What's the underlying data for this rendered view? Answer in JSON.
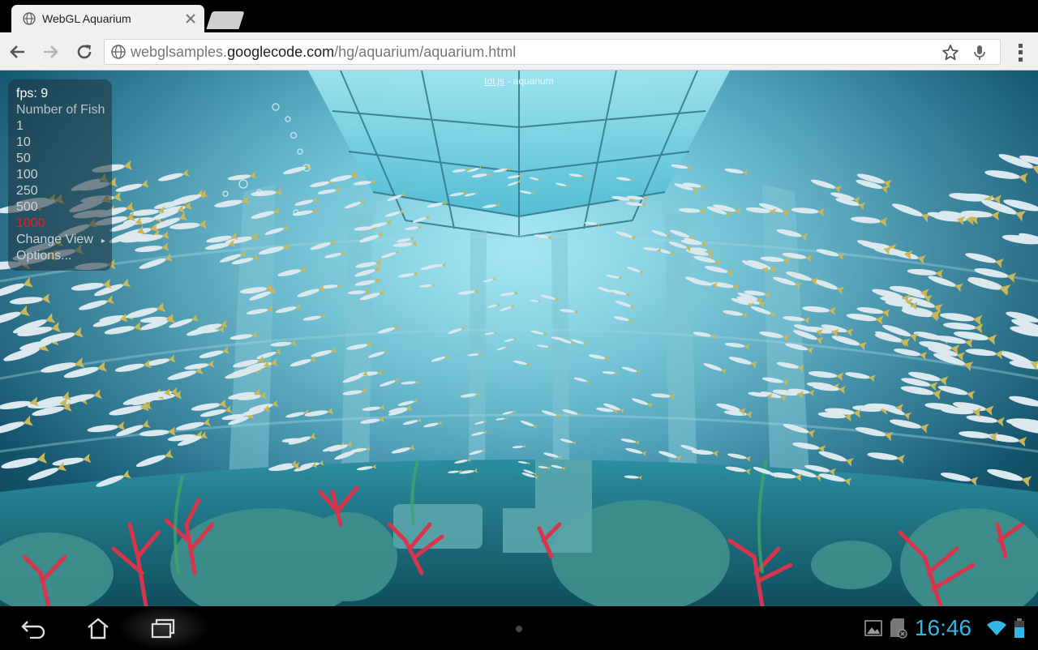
{
  "browser": {
    "tab": {
      "title": "WebGL Aquarium"
    },
    "url": {
      "prefix": "webglsamples.",
      "host": "googlecode.com",
      "path": "/hg/aquarium/aquarium.html"
    }
  },
  "page": {
    "caption_link": "tdl.js",
    "caption_rest": " - aquarium",
    "panel": {
      "fps": "fps: 9",
      "heading": "Number of Fish",
      "options": [
        "1",
        "10",
        "50",
        "100",
        "250",
        "500",
        "1000"
      ],
      "selected": "1000",
      "change_view": "Change View",
      "options_label": "Options..."
    }
  },
  "system": {
    "clock": "16:46"
  },
  "colors": {
    "selected_option": "#e41e1e",
    "clock": "#33b5e5"
  }
}
